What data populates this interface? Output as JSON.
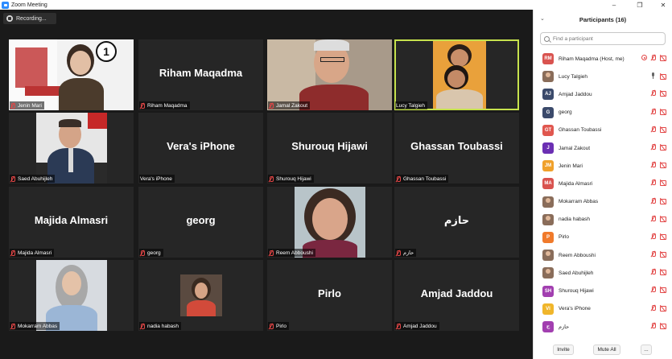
{
  "window": {
    "title": "Zoom Meeting"
  },
  "recording": {
    "label": "Recording..."
  },
  "tiles": [
    {
      "name": "Jenin Mari",
      "big": "",
      "icon_text": "1"
    },
    {
      "name": "Riham Maqadma",
      "big": "Riham Maqadma"
    },
    {
      "name": "Jamal Zakout",
      "big": ""
    },
    {
      "name": "Lucy Talgieh",
      "big": ""
    },
    {
      "name": "Saed Abuhijleh",
      "big": ""
    },
    {
      "name": "Vera's iPhone",
      "big": "Vera's iPhone"
    },
    {
      "name": "Shurouq Hijawi",
      "big": "Shurouq Hijawi"
    },
    {
      "name": "Ghassan Toubassi",
      "big": "Ghassan Toubassi"
    },
    {
      "name": "Majida Almasri",
      "big": "Majida Almasri"
    },
    {
      "name": "georg",
      "big": "georg"
    },
    {
      "name": "Reem Abboushi",
      "big": ""
    },
    {
      "name": "حازم",
      "big": "حازم"
    },
    {
      "name": "Mokarram Abbas",
      "big": ""
    },
    {
      "name": "nadia habash",
      "big": ""
    },
    {
      "name": "Pirlo",
      "big": "Pirlo"
    },
    {
      "name": "Amjad  Jaddou",
      "big": "Amjad  Jaddou"
    }
  ],
  "participants_panel": {
    "title": "Participants (16)",
    "search_placeholder": "Find a participant",
    "participants": [
      {
        "name": "Riham Maqadma (Host, me)",
        "initials": "RM",
        "color": "#d9534f"
      },
      {
        "name": "Lucy Talgieh",
        "initials": "",
        "color": "#8a6d5a"
      },
      {
        "name": "Amjad  Jaddou",
        "initials": "AJ",
        "color": "#3b4a6b"
      },
      {
        "name": "georg",
        "initials": "G",
        "color": "#3b4a6b"
      },
      {
        "name": "Ghassan Toubassi",
        "initials": "GT",
        "color": "#e0574f"
      },
      {
        "name": "Jamal Zakout",
        "initials": "J",
        "color": "#6b2fb3"
      },
      {
        "name": "Jenin Mari",
        "initials": "JM",
        "color": "#f0a12b"
      },
      {
        "name": "Majida Almasri",
        "initials": "MA",
        "color": "#d9534f"
      },
      {
        "name": "Mokarram Abbas",
        "initials": "",
        "color": "#8a6d5a"
      },
      {
        "name": "nadia habash",
        "initials": "",
        "color": "#8a6d5a"
      },
      {
        "name": "Pirlo",
        "initials": "P",
        "color": "#f07a2b"
      },
      {
        "name": "Reem Abboushi",
        "initials": "",
        "color": "#8a6d5a"
      },
      {
        "name": "Saed Abuhijleh",
        "initials": "",
        "color": "#8a6d5a"
      },
      {
        "name": "Shurouq Hijawi",
        "initials": "SH",
        "color": "#a23fb0"
      },
      {
        "name": "Vera's iPhone",
        "initials": "VI",
        "color": "#f0b62b"
      },
      {
        "name": "حازم",
        "initials": "ح",
        "color": "#a23fb0"
      }
    ],
    "invite_label": "Invite",
    "mute_all_label": "Mute All",
    "more_label": "..."
  }
}
